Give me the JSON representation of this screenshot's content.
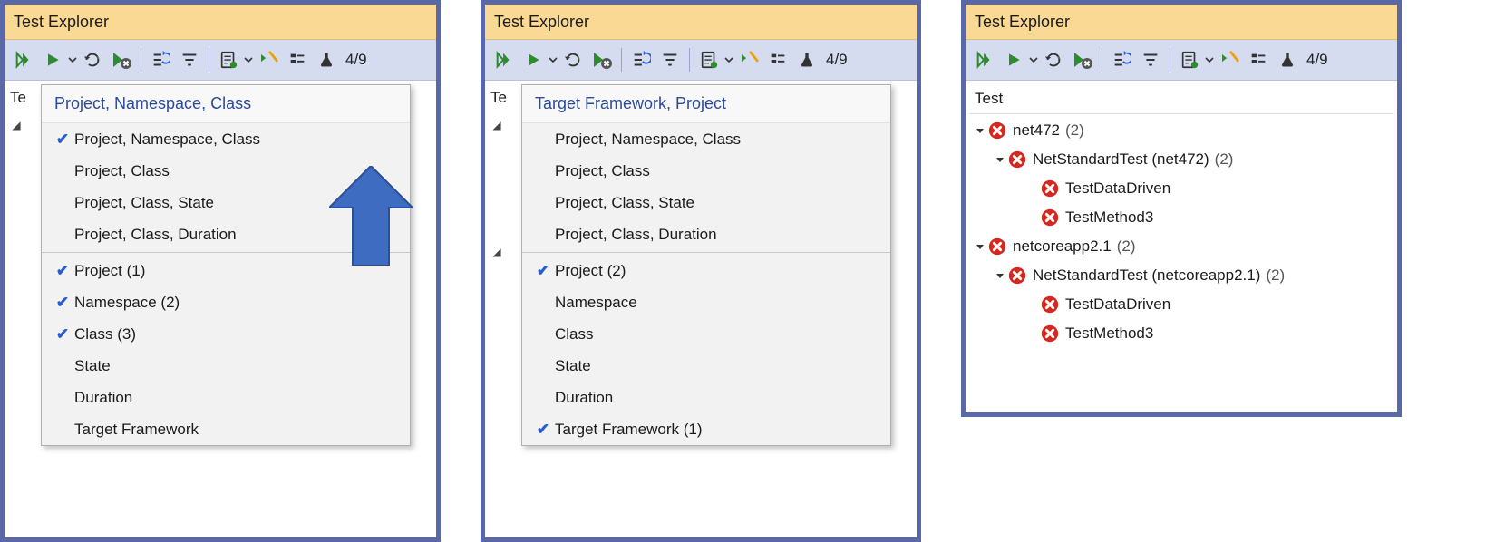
{
  "common": {
    "title": "Test Explorer",
    "test_count": "4/9",
    "peek_tab_label": "Test"
  },
  "menu1": {
    "header": "Project, Namespace, Class",
    "presets": [
      {
        "checked": true,
        "label": "Project, Namespace, Class"
      },
      {
        "checked": false,
        "label": "Project, Class"
      },
      {
        "checked": false,
        "label": "Project, Class, State"
      },
      {
        "checked": false,
        "label": "Project, Class, Duration"
      }
    ],
    "levels": [
      {
        "checked": true,
        "label": "Project (1)"
      },
      {
        "checked": true,
        "label": "Namespace (2)"
      },
      {
        "checked": true,
        "label": "Class (3)"
      },
      {
        "checked": false,
        "label": "State"
      },
      {
        "checked": false,
        "label": "Duration"
      },
      {
        "checked": false,
        "label": "Target Framework"
      }
    ]
  },
  "menu2": {
    "header": "Target Framework, Project",
    "presets": [
      {
        "checked": false,
        "label": "Project, Namespace, Class"
      },
      {
        "checked": false,
        "label": "Project, Class"
      },
      {
        "checked": false,
        "label": "Project, Class, State"
      },
      {
        "checked": false,
        "label": "Project, Class, Duration"
      }
    ],
    "levels": [
      {
        "checked": true,
        "label": "Project (2)"
      },
      {
        "checked": false,
        "label": "Namespace"
      },
      {
        "checked": false,
        "label": "Class"
      },
      {
        "checked": false,
        "label": "State"
      },
      {
        "checked": false,
        "label": "Duration"
      },
      {
        "checked": true,
        "label": "Target Framework (1)"
      }
    ]
  },
  "tree": {
    "header": "Test",
    "nodes": [
      {
        "depth": 0,
        "expanded": true,
        "fail": true,
        "label": "net472",
        "count": "(2)"
      },
      {
        "depth": 1,
        "expanded": true,
        "fail": true,
        "label": "NetStandardTest (net472)",
        "count": "(2)"
      },
      {
        "depth": 2,
        "expanded": false,
        "fail": true,
        "label": "TestDataDriven",
        "count": ""
      },
      {
        "depth": 2,
        "expanded": false,
        "fail": true,
        "label": "TestMethod3",
        "count": ""
      },
      {
        "depth": 0,
        "expanded": true,
        "fail": true,
        "label": "netcoreapp2.1",
        "count": "(2)"
      },
      {
        "depth": 1,
        "expanded": true,
        "fail": true,
        "label": "NetStandardTest (netcoreapp2.1)",
        "count": "(2)"
      },
      {
        "depth": 2,
        "expanded": false,
        "fail": true,
        "label": "TestDataDriven",
        "count": ""
      },
      {
        "depth": 2,
        "expanded": false,
        "fail": true,
        "label": "TestMethod3",
        "count": ""
      }
    ]
  }
}
